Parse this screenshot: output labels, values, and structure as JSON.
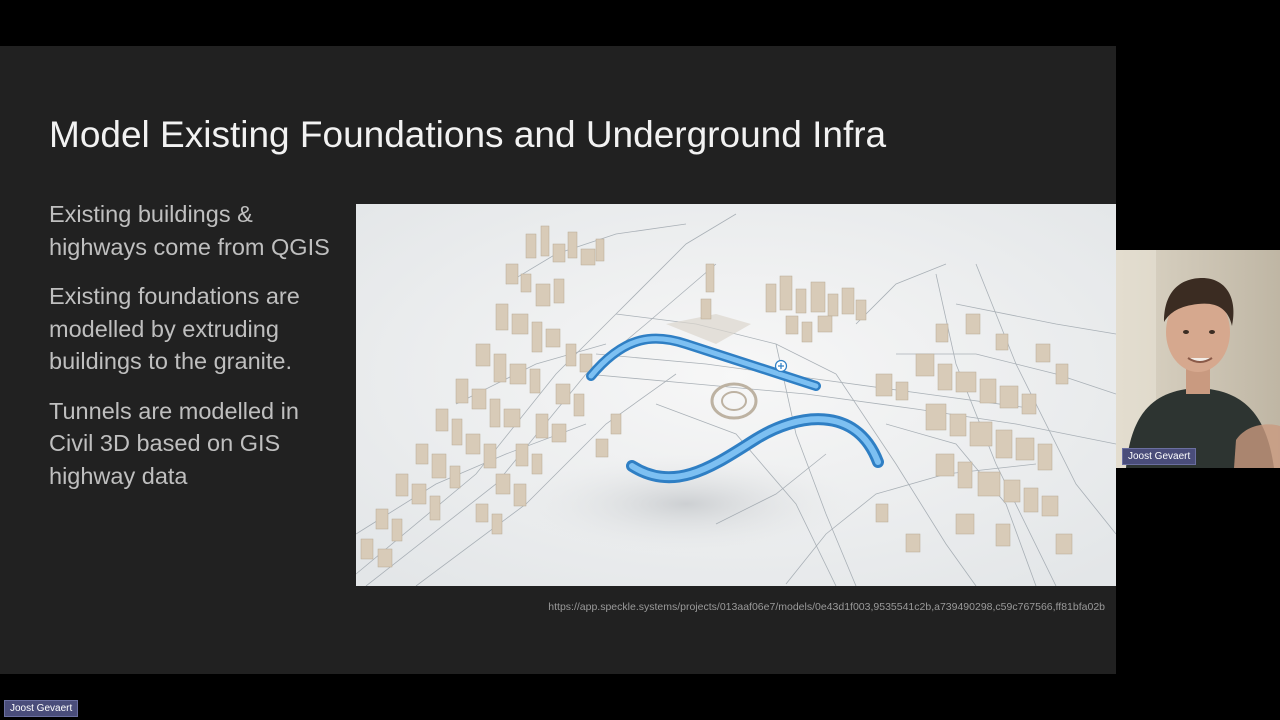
{
  "slide": {
    "title": "Model Existing Foundations and Underground Infra",
    "bullets": [
      "Existing buildings & highways come from QGIS",
      "Existing foundations are modelled by extruding buildings to the granite.",
      "Tunnels are modelled in Civil 3D based on GIS highway data"
    ],
    "source_url": "https://app.speckle.systems/projects/013aaf06e7/models/0e43d1f003,9535541c2b,a739490298,c59c767566,ff81bfa02b"
  },
  "participant": {
    "name_tag": "Joost Gevaert"
  },
  "self_view": {
    "name_tag": "Joost Gevaert"
  },
  "colors": {
    "slide_background": "#212121",
    "title": "#f2f2f2",
    "body_text": "#bfbfbf",
    "tunnel": "#4a9fe0",
    "building": "#d8cbb8",
    "name_badge": "#4a4d7a"
  },
  "icons": {
    "viewer_cursor": "plus-circle-icon"
  }
}
